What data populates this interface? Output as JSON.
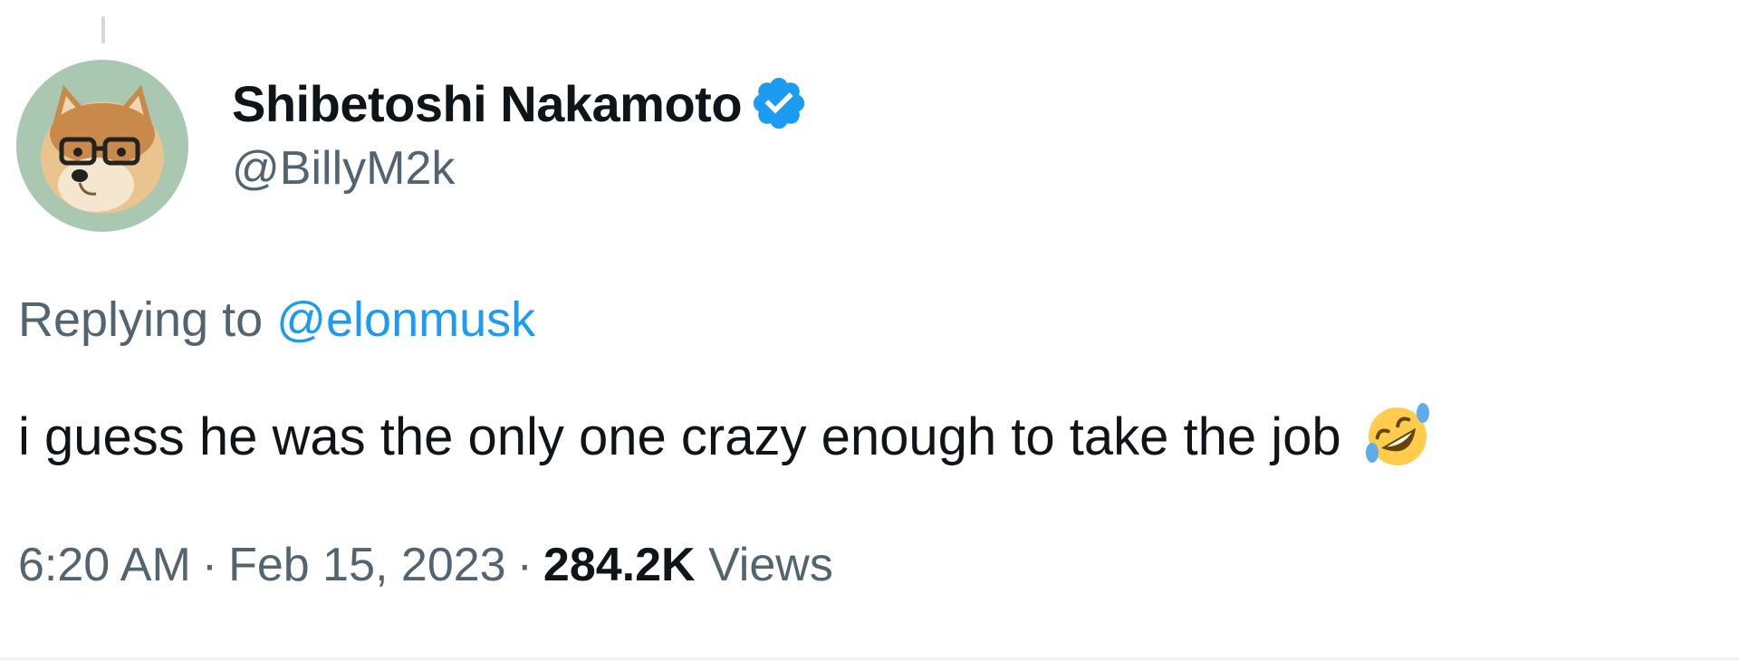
{
  "tweet": {
    "author": {
      "display_name": "Shibetoshi Nakamoto",
      "handle": "@BillyM2k",
      "verified": true,
      "avatar_icon": "doge-with-glasses-avatar"
    },
    "replying_to_prefix": "Replying to",
    "replying_to_handle": "@elonmusk",
    "text": "i guess he was the only one crazy enough to take the job",
    "emoji": "rolling-on-floor-laughing-emoji",
    "time": "6:20 AM",
    "date": "Feb 15, 2023",
    "separator": "·",
    "views_count": "284.2K",
    "views_label": "Views"
  },
  "colors": {
    "text_primary": "#0f1419",
    "text_secondary": "#536471",
    "link": "#1d9bf0",
    "verified_badge": "#1d9bf0",
    "avatar_background": "#a9c7b1"
  }
}
